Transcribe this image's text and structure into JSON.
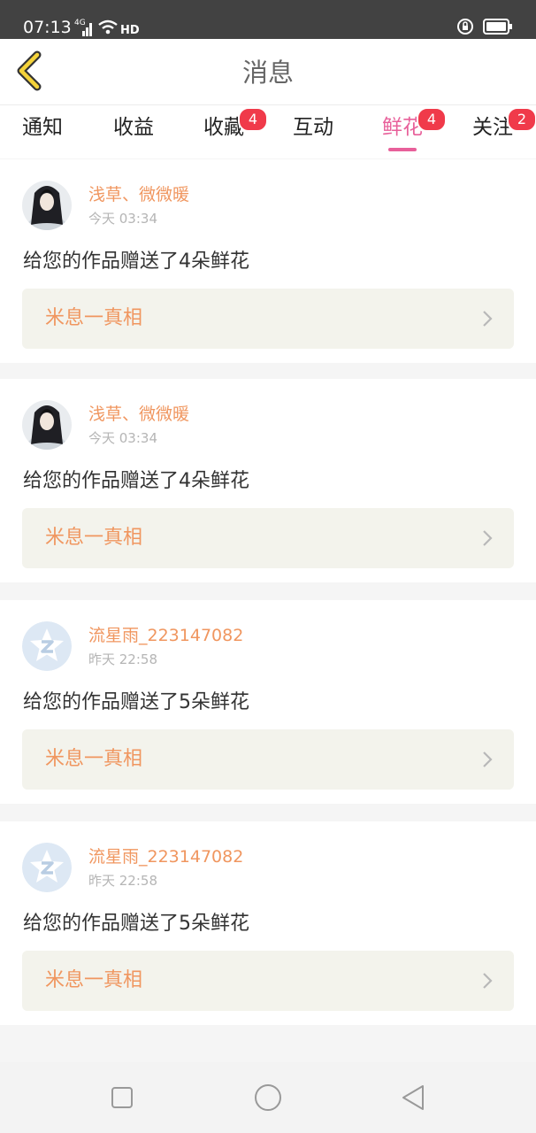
{
  "status_bar": {
    "time": "07:13",
    "network": "4G",
    "wifi_label": "HD",
    "icons": [
      "signal-icon",
      "wifi-icon",
      "lock-rotation-icon",
      "battery-icon"
    ]
  },
  "header": {
    "title": "消息",
    "back_icon": "chevron-left-icon"
  },
  "tabs": [
    {
      "label": "通知",
      "badge": null,
      "active": false
    },
    {
      "label": "收益",
      "badge": null,
      "active": false
    },
    {
      "label": "收藏",
      "badge": "4",
      "active": false
    },
    {
      "label": "互动",
      "badge": null,
      "active": false
    },
    {
      "label": "鲜花",
      "badge": "4",
      "active": true
    },
    {
      "label": "关注",
      "badge": "2",
      "active": false
    }
  ],
  "messages": [
    {
      "user": "浅草、微微暖",
      "time": "今天 03:34",
      "text": "给您的作品赠送了4朵鲜花",
      "work": "米息一真相",
      "avatar": "illustrated-portrait"
    },
    {
      "user": "浅草、微微暖",
      "time": "今天 03:34",
      "text": "给您的作品赠送了4朵鲜花",
      "work": "米息一真相",
      "avatar": "illustrated-portrait"
    },
    {
      "user": "流星雨_223147082",
      "time": "昨天 22:58",
      "text": "给您的作品赠送了5朵鲜花",
      "work": "米息一真相",
      "avatar": "default-z-avatar"
    },
    {
      "user": "流星雨_223147082",
      "time": "昨天 22:58",
      "text": "给您的作品赠送了5朵鲜花",
      "work": "米息一真相",
      "avatar": "default-z-avatar"
    }
  ],
  "colors": {
    "accent": "#e8609a",
    "username": "#f0965f",
    "badge": "#f03a4a",
    "work_bg": "#f3f3ec"
  },
  "nav_bar": {
    "buttons": [
      "recent-apps-icon",
      "home-icon",
      "back-triangle-icon"
    ]
  }
}
